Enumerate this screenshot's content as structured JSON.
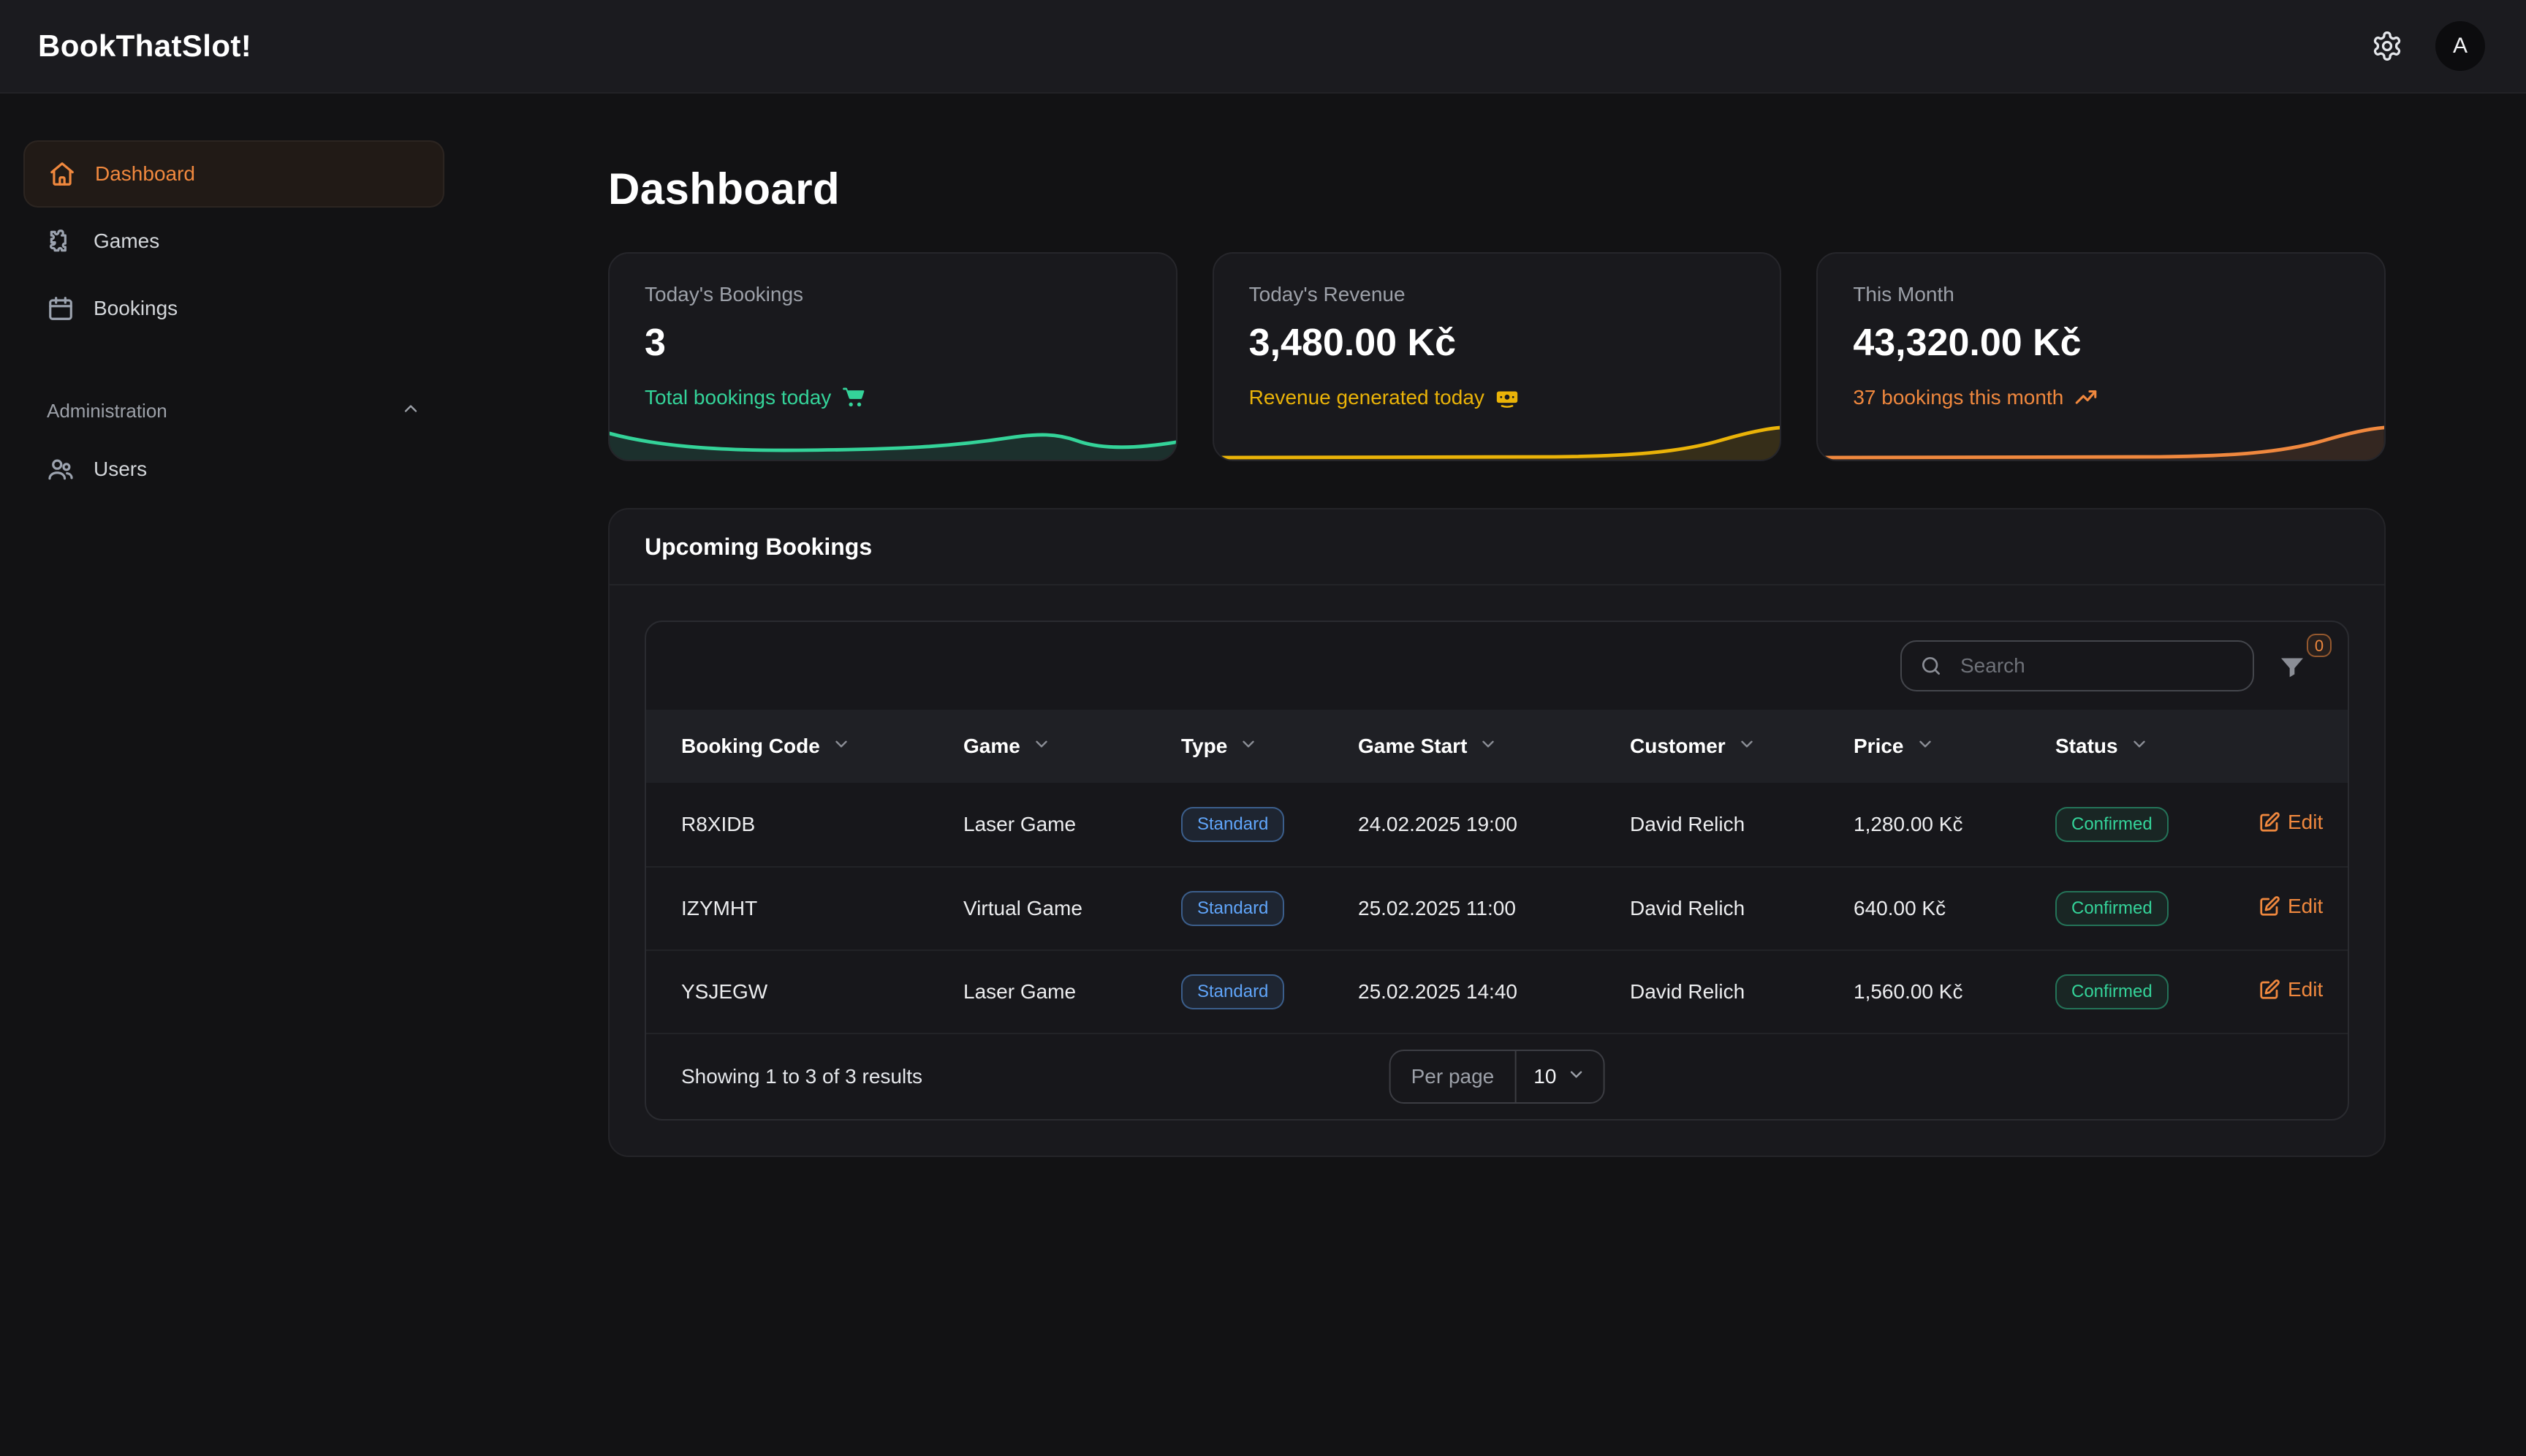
{
  "app": {
    "title": "BookThatSlot!",
    "avatar_initial": "A",
    "header_icons": [
      "settings-gear-icon",
      "avatar"
    ]
  },
  "sidebar": {
    "items": [
      {
        "label": "Dashboard",
        "icon": "home-icon",
        "active": true
      },
      {
        "label": "Games",
        "icon": "puzzle-icon",
        "active": false
      },
      {
        "label": "Bookings",
        "icon": "calendar-icon",
        "active": false
      }
    ],
    "section": {
      "label": "Administration",
      "icon": "chevron-up-icon",
      "expanded": true
    },
    "admin_items": [
      {
        "label": "Users",
        "icon": "users-icon",
        "active": false
      }
    ]
  },
  "page": {
    "title": "Dashboard"
  },
  "colors": {
    "green": "#34d399",
    "yellow": "#eab308",
    "orange": "#f0883e",
    "blue": "#60a5fa"
  },
  "stats": [
    {
      "label": "Today's Bookings",
      "value": "3",
      "sub": "Total bookings today",
      "icon": "shopping-cart-icon",
      "accent": "#34d399",
      "sparkline": "wave"
    },
    {
      "label": "Today's Revenue",
      "value": "3,480.00 Kč",
      "sub": "Revenue generated today",
      "icon": "banknote-icon",
      "accent": "#eab308",
      "sparkline": "rise"
    },
    {
      "label": "This Month",
      "value": "43,320.00 Kč",
      "sub": "37 bookings this month",
      "icon": "trending-up-icon",
      "accent": "#f0883e",
      "sparkline": "rise"
    }
  ],
  "bookings_panel": {
    "title": "Upcoming Bookings",
    "search": {
      "placeholder": "Search",
      "icon": "search-icon"
    },
    "filter": {
      "icon": "filter-funnel-icon",
      "count": "0"
    },
    "table": {
      "columns": [
        "Booking Code",
        "Game",
        "Type",
        "Game Start",
        "Customer",
        "Price",
        "Status"
      ],
      "rows": [
        {
          "code": "R8XIDB",
          "game": "Laser Game",
          "type": "Standard",
          "start": "24.02.2025 19:00",
          "customer": "David Relich",
          "price": "1,280.00 Kč",
          "status": "Confirmed",
          "action": "Edit"
        },
        {
          "code": "IZYMHT",
          "game": "Virtual Game",
          "type": "Standard",
          "start": "25.02.2025 11:00",
          "customer": "David Relich",
          "price": "640.00 Kč",
          "status": "Confirmed",
          "action": "Edit"
        },
        {
          "code": "YSJEGW",
          "game": "Laser Game",
          "type": "Standard",
          "start": "25.02.2025 14:40",
          "customer": "David Relich",
          "price": "1,560.00 Kč",
          "status": "Confirmed",
          "action": "Edit"
        }
      ]
    },
    "footer": {
      "summary": "Showing 1 to 3 of 3 results",
      "per_page_label": "Per page",
      "per_page_value": "10"
    }
  }
}
